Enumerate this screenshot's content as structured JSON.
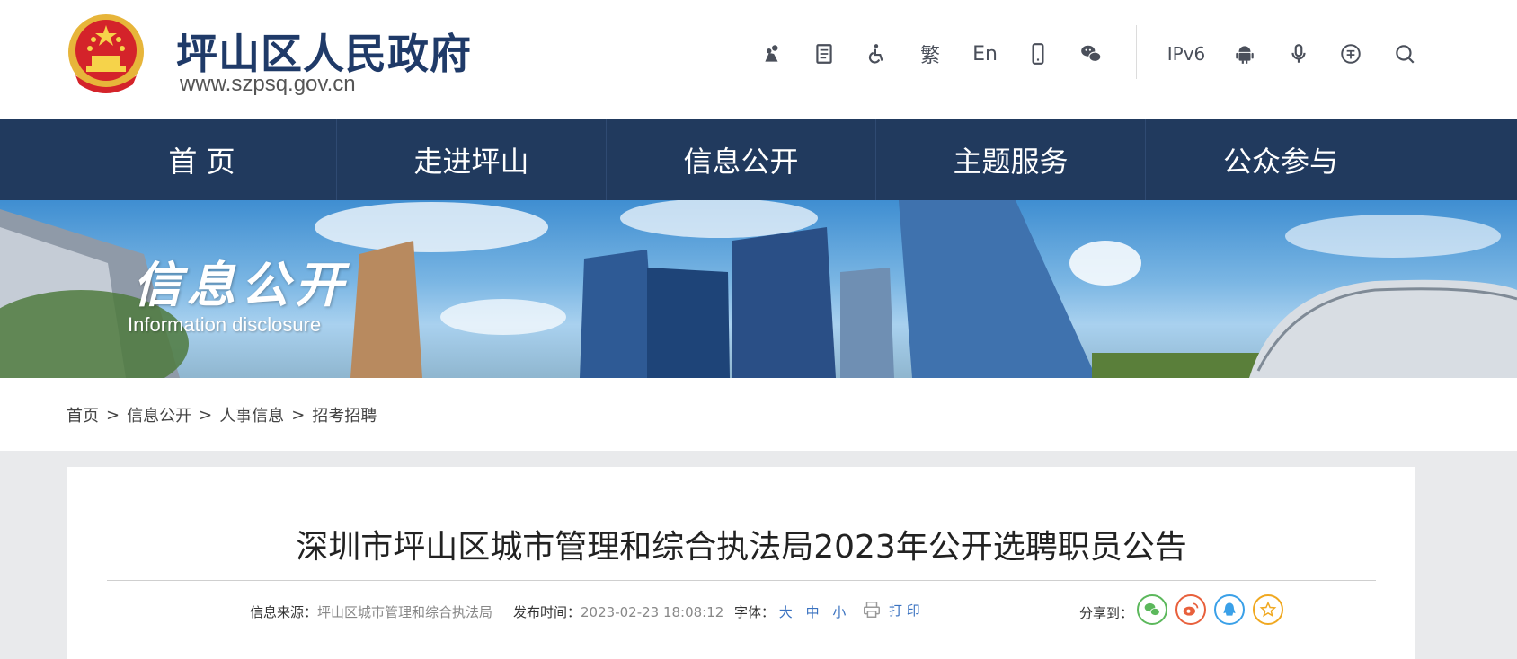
{
  "header": {
    "site_title": "坪山区人民政府",
    "site_url": "www.szpsq.gov.cn",
    "tools": {
      "traditional": "繁",
      "english": "En",
      "ipv6": "IPv6"
    }
  },
  "nav": {
    "items": [
      "首 页",
      "走进坪山",
      "信息公开",
      "主题服务",
      "公众参与"
    ]
  },
  "banner": {
    "title": "信息公开",
    "subtitle": "Information disclosure"
  },
  "breadcrumb": {
    "items": [
      "首页",
      "信息公开",
      "人事信息",
      "招考招聘"
    ],
    "separator": ">"
  },
  "article": {
    "title": "深圳市坪山区城市管理和综合执法局2023年公开选聘职员公告",
    "source_label": "信息来源：",
    "source_value": "坪山区城市管理和综合执法局",
    "time_label": "发布时间：",
    "time_value": "2023-02-23 18:08:12",
    "font_label": "字体：",
    "font_large": "大",
    "font_medium": "中",
    "font_small": "小",
    "print_label": "打 印",
    "share_label": "分享到："
  },
  "colors": {
    "nav_bg": "#213a5e",
    "title_blue": "#1f3a68",
    "wechat": "#5cb85c",
    "weibo": "#e8603c",
    "qq": "#3aa0e8",
    "favorite": "#f0a820"
  }
}
